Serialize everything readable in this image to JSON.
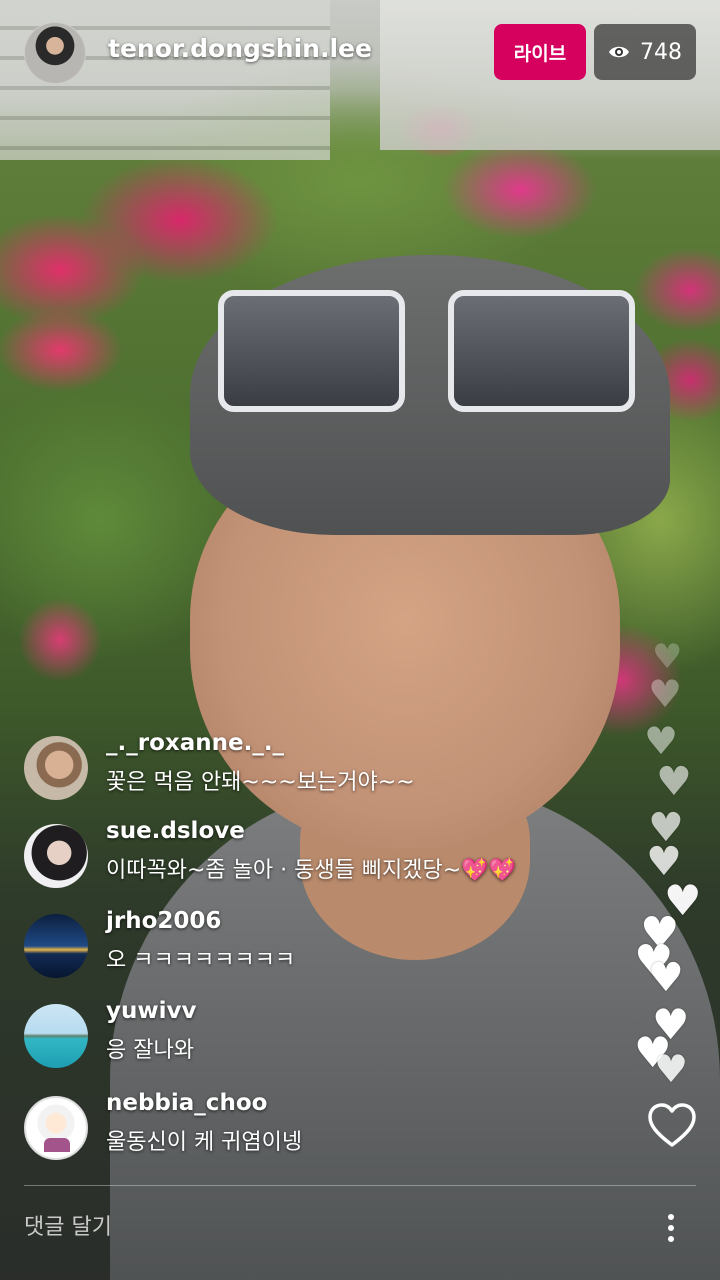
{
  "host": {
    "username": "tenor.dongshin.lee",
    "avatar_icon": "user-avatar-photo"
  },
  "live": {
    "label": "라이브",
    "color": "#d6005f"
  },
  "viewers": {
    "icon": "eye-icon",
    "count": "748"
  },
  "comments": [
    {
      "user": "_._roxanne._._",
      "text": "꽃은 먹음 안돼~~~보는거야~~"
    },
    {
      "user": "sue.dslove",
      "text": "이따꼭와~좀 놀아 · 동생들 삐지겠당~💖💖"
    },
    {
      "user": "jrho2006",
      "text": "오 ㅋㅋㅋㅋㅋㅋㅋㅋ"
    },
    {
      "user": "yuwivv",
      "text": "응 잘나와"
    },
    {
      "user": "nebbia_choo",
      "text": "울동신이 케 귀염이넹"
    }
  ],
  "composer": {
    "placeholder": "댓글 달기",
    "more_icon": "more-vertical-icon"
  },
  "reactions": {
    "icon": "heart-icon"
  }
}
